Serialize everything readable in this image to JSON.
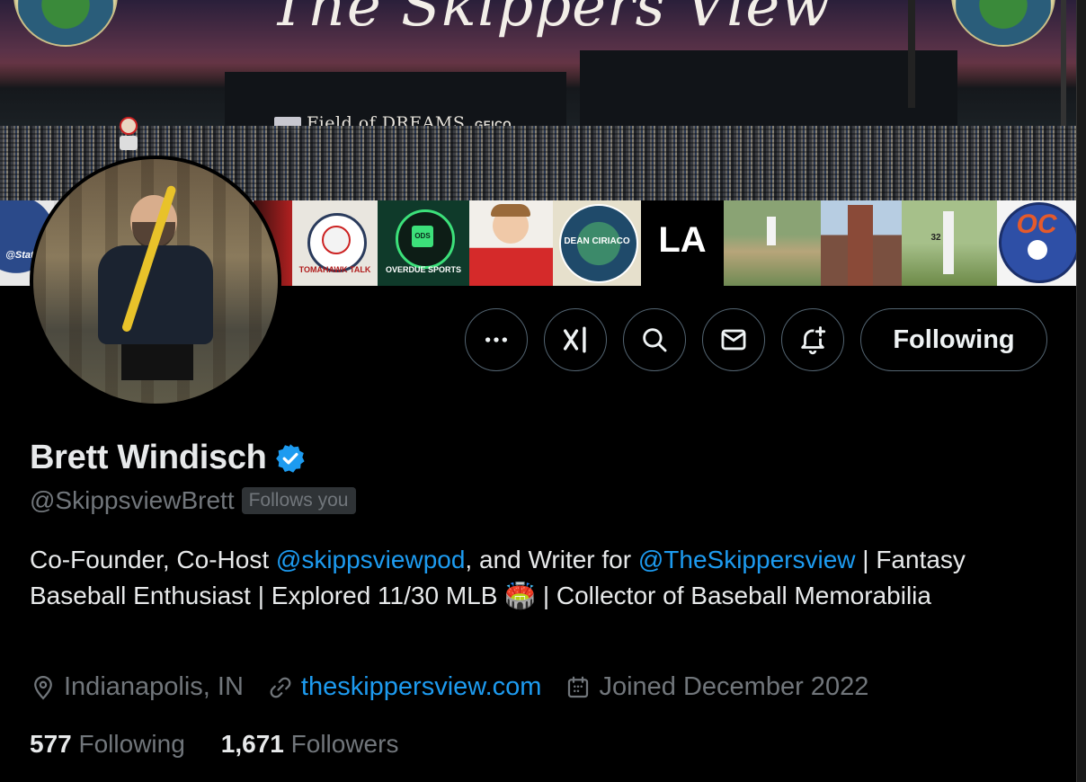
{
  "banner": {
    "title": "The Skippers View",
    "sign_text": "Field of DREAMS",
    "sign_sponsor": "GEICO",
    "strip_labels": {
      "stats_tile": "@Stats",
      "tomahawk": "TOMAHAWK TALK",
      "overdue": "OVERDUE SPORTS",
      "overdue_badge": "ODS",
      "dean": "DEAN CIRIACO",
      "la": "LA",
      "oc": "OC",
      "player_number": "32"
    }
  },
  "actions": {
    "more_label": "More",
    "grok_label": "Grok",
    "search_label": "Search",
    "message_label": "Message",
    "notify_label": "Notifications",
    "follow_label": "Following"
  },
  "profile": {
    "name": "Brett Windisch",
    "handle": "@SkippsviewBrett",
    "follows_you": "Follows you",
    "bio_part1": "Co-Founder, Co-Host ",
    "bio_link1": "@skippsviewpod",
    "bio_part2": ", and Writer for ",
    "bio_link2": "@TheSkippersview",
    "bio_part3": " | Fantasy Baseball Enthusiast | Explored 11/30 MLB ",
    "bio_emoji": "🏟️",
    "bio_part4": " | Collector of Baseball Memorabilia",
    "location": "Indianapolis, IN",
    "website": "theskippersview.com",
    "joined": "Joined December 2022",
    "following_count": "577",
    "following_label": "Following",
    "followers_count": "1,671",
    "followers_label": "Followers"
  },
  "colors": {
    "accent": "#1d9bf0",
    "muted": "#71767b",
    "text": "#e7e9ea",
    "border": "#536471",
    "verified": "#1d9bf0"
  }
}
